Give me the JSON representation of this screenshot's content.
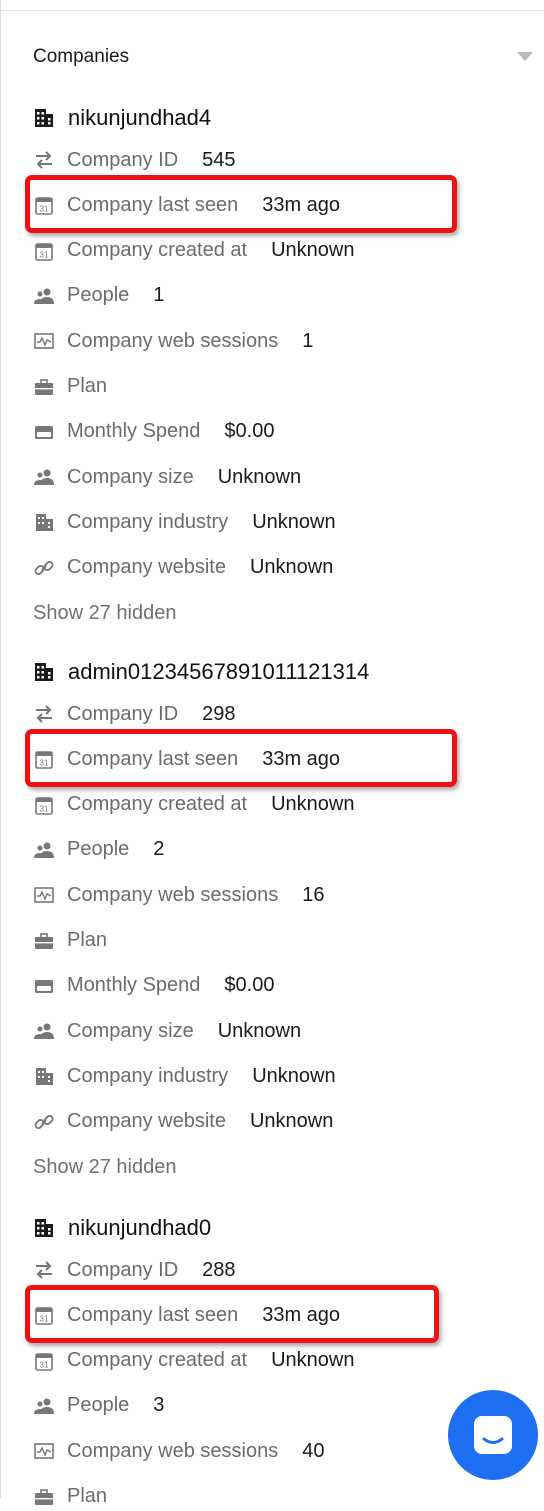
{
  "section": {
    "title": "Companies"
  },
  "companies": [
    {
      "name": "nikunjundhad4",
      "attributes": [
        {
          "icon": "transfer-arrows-icon",
          "label": "Company ID",
          "value": "545",
          "highlighted": false
        },
        {
          "icon": "calendar-icon",
          "label": "Company last seen",
          "value": "33m ago",
          "highlighted": true
        },
        {
          "icon": "calendar-icon",
          "label": "Company created at",
          "value": "Unknown",
          "highlighted": false
        },
        {
          "icon": "people-icon",
          "label": "People",
          "value": "1",
          "highlighted": false
        },
        {
          "icon": "activity-icon",
          "label": "Company web sessions",
          "value": "1",
          "highlighted": false
        },
        {
          "icon": "briefcase-icon",
          "label": "Plan",
          "value": "",
          "highlighted": false
        },
        {
          "icon": "credit-card-icon",
          "label": "Monthly Spend",
          "value": "$0.00",
          "highlighted": false
        },
        {
          "icon": "people-icon",
          "label": "Company size",
          "value": "Unknown",
          "highlighted": false
        },
        {
          "icon": "building-icon",
          "label": "Company industry",
          "value": "Unknown",
          "highlighted": false
        },
        {
          "icon": "link-icon",
          "label": "Company website",
          "value": "Unknown",
          "highlighted": false
        }
      ],
      "show_hidden": "Show 27 hidden"
    },
    {
      "name": "admin01234567891011121314",
      "attributes": [
        {
          "icon": "transfer-arrows-icon",
          "label": "Company ID",
          "value": "298",
          "highlighted": false
        },
        {
          "icon": "calendar-icon",
          "label": "Company last seen",
          "value": "33m ago",
          "highlighted": true
        },
        {
          "icon": "calendar-icon",
          "label": "Company created at",
          "value": "Unknown",
          "highlighted": false
        },
        {
          "icon": "people-icon",
          "label": "People",
          "value": "2",
          "highlighted": false
        },
        {
          "icon": "activity-icon",
          "label": "Company web sessions",
          "value": "16",
          "highlighted": false
        },
        {
          "icon": "briefcase-icon",
          "label": "Plan",
          "value": "",
          "highlighted": false
        },
        {
          "icon": "credit-card-icon",
          "label": "Monthly Spend",
          "value": "$0.00",
          "highlighted": false
        },
        {
          "icon": "people-icon",
          "label": "Company size",
          "value": "Unknown",
          "highlighted": false
        },
        {
          "icon": "building-icon",
          "label": "Company industry",
          "value": "Unknown",
          "highlighted": false
        },
        {
          "icon": "link-icon",
          "label": "Company website",
          "value": "Unknown",
          "highlighted": false
        }
      ],
      "show_hidden": "Show 27 hidden"
    },
    {
      "name": "nikunjundhad0",
      "attributes": [
        {
          "icon": "transfer-arrows-icon",
          "label": "Company ID",
          "value": "288",
          "highlighted": false
        },
        {
          "icon": "calendar-icon",
          "label": "Company last seen",
          "value": "33m ago",
          "highlighted": true
        },
        {
          "icon": "calendar-icon",
          "label": "Company created at",
          "value": "Unknown",
          "highlighted": false
        },
        {
          "icon": "people-icon",
          "label": "People",
          "value": "3",
          "highlighted": false
        },
        {
          "icon": "activity-icon",
          "label": "Company web sessions",
          "value": "40",
          "highlighted": false
        },
        {
          "icon": "briefcase-icon",
          "label": "Plan",
          "value": "",
          "highlighted": false
        }
      ],
      "show_hidden": ""
    }
  ],
  "colors": {
    "highlight": "#ee1111",
    "launcher": "#1f6ff2",
    "label": "#6b6b6b",
    "value": "#1a1a1a"
  },
  "launcher": {
    "icon": "chat-bubble-icon"
  }
}
